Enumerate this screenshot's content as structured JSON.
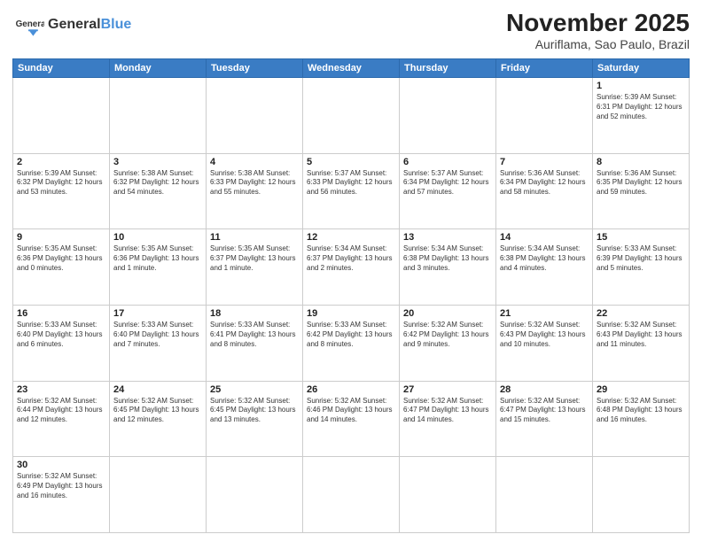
{
  "header": {
    "logo_text_normal": "General",
    "logo_text_blue": "Blue",
    "title": "November 2025",
    "subtitle": "Auriflama, Sao Paulo, Brazil"
  },
  "days_of_week": [
    "Sunday",
    "Monday",
    "Tuesday",
    "Wednesday",
    "Thursday",
    "Friday",
    "Saturday"
  ],
  "weeks": [
    [
      {
        "day": "",
        "info": ""
      },
      {
        "day": "",
        "info": ""
      },
      {
        "day": "",
        "info": ""
      },
      {
        "day": "",
        "info": ""
      },
      {
        "day": "",
        "info": ""
      },
      {
        "day": "",
        "info": ""
      },
      {
        "day": "1",
        "info": "Sunrise: 5:39 AM\nSunset: 6:31 PM\nDaylight: 12 hours\nand 52 minutes."
      }
    ],
    [
      {
        "day": "2",
        "info": "Sunrise: 5:39 AM\nSunset: 6:32 PM\nDaylight: 12 hours\nand 53 minutes."
      },
      {
        "day": "3",
        "info": "Sunrise: 5:38 AM\nSunset: 6:32 PM\nDaylight: 12 hours\nand 54 minutes."
      },
      {
        "day": "4",
        "info": "Sunrise: 5:38 AM\nSunset: 6:33 PM\nDaylight: 12 hours\nand 55 minutes."
      },
      {
        "day": "5",
        "info": "Sunrise: 5:37 AM\nSunset: 6:33 PM\nDaylight: 12 hours\nand 56 minutes."
      },
      {
        "day": "6",
        "info": "Sunrise: 5:37 AM\nSunset: 6:34 PM\nDaylight: 12 hours\nand 57 minutes."
      },
      {
        "day": "7",
        "info": "Sunrise: 5:36 AM\nSunset: 6:34 PM\nDaylight: 12 hours\nand 58 minutes."
      },
      {
        "day": "8",
        "info": "Sunrise: 5:36 AM\nSunset: 6:35 PM\nDaylight: 12 hours\nand 59 minutes."
      }
    ],
    [
      {
        "day": "9",
        "info": "Sunrise: 5:35 AM\nSunset: 6:36 PM\nDaylight: 13 hours\nand 0 minutes."
      },
      {
        "day": "10",
        "info": "Sunrise: 5:35 AM\nSunset: 6:36 PM\nDaylight: 13 hours\nand 1 minute."
      },
      {
        "day": "11",
        "info": "Sunrise: 5:35 AM\nSunset: 6:37 PM\nDaylight: 13 hours\nand 1 minute."
      },
      {
        "day": "12",
        "info": "Sunrise: 5:34 AM\nSunset: 6:37 PM\nDaylight: 13 hours\nand 2 minutes."
      },
      {
        "day": "13",
        "info": "Sunrise: 5:34 AM\nSunset: 6:38 PM\nDaylight: 13 hours\nand 3 minutes."
      },
      {
        "day": "14",
        "info": "Sunrise: 5:34 AM\nSunset: 6:38 PM\nDaylight: 13 hours\nand 4 minutes."
      },
      {
        "day": "15",
        "info": "Sunrise: 5:33 AM\nSunset: 6:39 PM\nDaylight: 13 hours\nand 5 minutes."
      }
    ],
    [
      {
        "day": "16",
        "info": "Sunrise: 5:33 AM\nSunset: 6:40 PM\nDaylight: 13 hours\nand 6 minutes."
      },
      {
        "day": "17",
        "info": "Sunrise: 5:33 AM\nSunset: 6:40 PM\nDaylight: 13 hours\nand 7 minutes."
      },
      {
        "day": "18",
        "info": "Sunrise: 5:33 AM\nSunset: 6:41 PM\nDaylight: 13 hours\nand 8 minutes."
      },
      {
        "day": "19",
        "info": "Sunrise: 5:33 AM\nSunset: 6:42 PM\nDaylight: 13 hours\nand 8 minutes."
      },
      {
        "day": "20",
        "info": "Sunrise: 5:32 AM\nSunset: 6:42 PM\nDaylight: 13 hours\nand 9 minutes."
      },
      {
        "day": "21",
        "info": "Sunrise: 5:32 AM\nSunset: 6:43 PM\nDaylight: 13 hours\nand 10 minutes."
      },
      {
        "day": "22",
        "info": "Sunrise: 5:32 AM\nSunset: 6:43 PM\nDaylight: 13 hours\nand 11 minutes."
      }
    ],
    [
      {
        "day": "23",
        "info": "Sunrise: 5:32 AM\nSunset: 6:44 PM\nDaylight: 13 hours\nand 12 minutes."
      },
      {
        "day": "24",
        "info": "Sunrise: 5:32 AM\nSunset: 6:45 PM\nDaylight: 13 hours\nand 12 minutes."
      },
      {
        "day": "25",
        "info": "Sunrise: 5:32 AM\nSunset: 6:45 PM\nDaylight: 13 hours\nand 13 minutes."
      },
      {
        "day": "26",
        "info": "Sunrise: 5:32 AM\nSunset: 6:46 PM\nDaylight: 13 hours\nand 14 minutes."
      },
      {
        "day": "27",
        "info": "Sunrise: 5:32 AM\nSunset: 6:47 PM\nDaylight: 13 hours\nand 14 minutes."
      },
      {
        "day": "28",
        "info": "Sunrise: 5:32 AM\nSunset: 6:47 PM\nDaylight: 13 hours\nand 15 minutes."
      },
      {
        "day": "29",
        "info": "Sunrise: 5:32 AM\nSunset: 6:48 PM\nDaylight: 13 hours\nand 16 minutes."
      }
    ],
    [
      {
        "day": "30",
        "info": "Sunrise: 5:32 AM\nSunset: 6:49 PM\nDaylight: 13 hours\nand 16 minutes."
      },
      {
        "day": "",
        "info": ""
      },
      {
        "day": "",
        "info": ""
      },
      {
        "day": "",
        "info": ""
      },
      {
        "day": "",
        "info": ""
      },
      {
        "day": "",
        "info": ""
      },
      {
        "day": "",
        "info": ""
      }
    ]
  ]
}
